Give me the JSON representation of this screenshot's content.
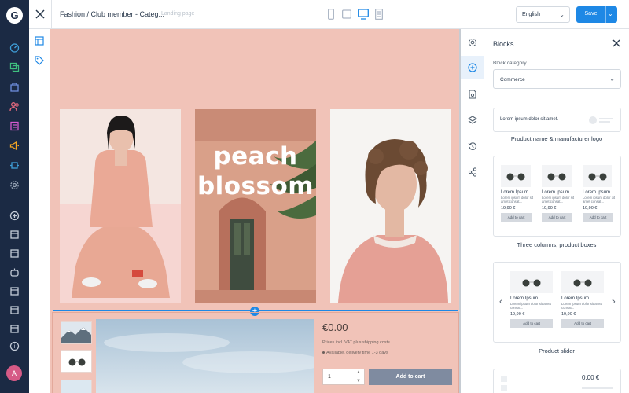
{
  "brand": {
    "logo_letter": "G"
  },
  "nav": {
    "icons": [
      "dashboard-icon",
      "catalogue-icon",
      "orders-icon",
      "customers-icon",
      "content-icon",
      "marketing-icon",
      "extensions-icon",
      "settings-icon",
      "add-sales-channel-icon",
      "storefront-icon",
      "storefront-icon",
      "headless-icon",
      "storefront-icon",
      "storefront-icon",
      "help-icon"
    ],
    "avatar": "A"
  },
  "topbar": {
    "title": "Fashion / Club member - Categ...",
    "subtitle": "Landing page",
    "devices": [
      "mobile-icon",
      "tablet-icon",
      "desktop-icon",
      "form-icon"
    ],
    "language": "English",
    "save_label": "Save"
  },
  "canvas": {
    "overlay_line1": "peach",
    "overlay_line2": "blossom",
    "price": "€0.00",
    "tax_info": "Prices incl. VAT plus shipping costs",
    "availability": "Available, delivery time 1-3 days",
    "quantity": "1",
    "add_to_cart": "Add to cart"
  },
  "panel": {
    "title": "Blocks",
    "category_label": "Block category",
    "category_value": "Commerce",
    "blocks": [
      {
        "caption": "Product name & manufacturer logo",
        "preview_text": "Lorem ipsum dolor sit amet."
      },
      {
        "caption": "Three columns, product boxes",
        "product_name": "Lorem Ipsum",
        "product_desc": "Lorem ipsum dolor sit amet consat...",
        "product_price": "19,90 €",
        "button": "Add to cart"
      },
      {
        "caption": "Product slider",
        "product_name": "Lorem Ipsum",
        "product_desc": "Lorem ipsum dolor sit amet consat...",
        "product_price": "19,90 €",
        "button": "Add to cart"
      },
      {
        "preview_price": "0,00 €"
      }
    ]
  },
  "colors": {
    "nav_bg": "#1b2a44",
    "accent": "#1e88e5",
    "canvas_bg": "#f1c3b8",
    "nav_active": "#f5a623"
  }
}
